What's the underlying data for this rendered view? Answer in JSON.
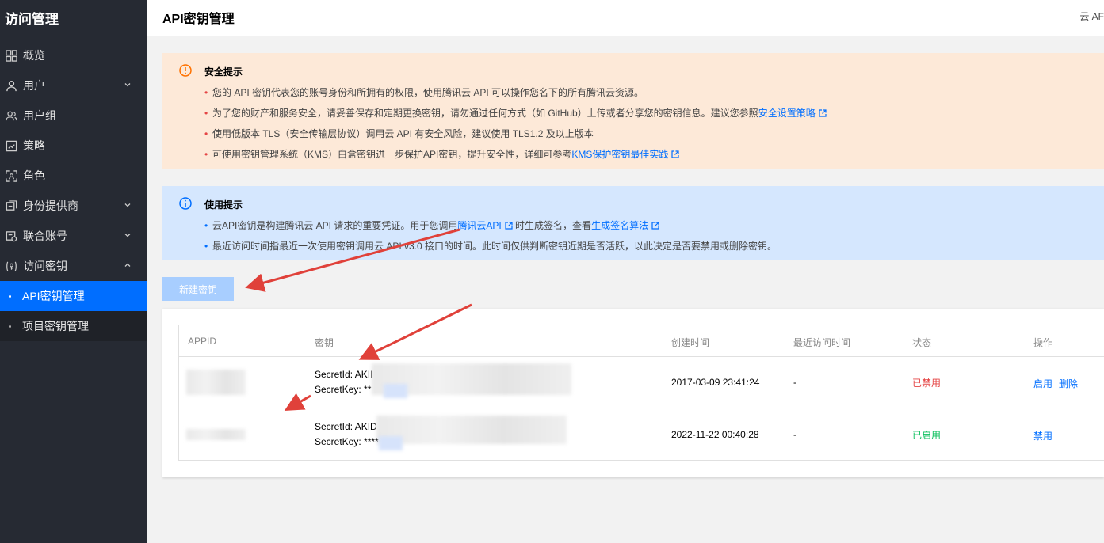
{
  "sidebar": {
    "title": "访问管理",
    "items": [
      {
        "label": "概览"
      },
      {
        "label": "用户"
      },
      {
        "label": "用户组"
      },
      {
        "label": "策略"
      },
      {
        "label": "角色"
      },
      {
        "label": "身份提供商"
      },
      {
        "label": "联合账号"
      },
      {
        "label": "访问密钥"
      }
    ],
    "sub_items": [
      {
        "label": "API密钥管理"
      },
      {
        "label": "项目密钥管理"
      }
    ]
  },
  "header": {
    "title": "API密钥管理",
    "right_text": "云 AF"
  },
  "security_notice": {
    "title": "安全提示",
    "items": [
      "您的 API 密钥代表您的账号身份和所拥有的权限，使用腾讯云 API 可以操作您名下的所有腾讯云资源。",
      "为了您的财产和服务安全，请妥善保存和定期更换密钥，请勿通过任何方式（如 GitHub）上传或者分享您的密钥信息。建议您参照",
      "使用低版本 TLS（安全传输层协议）调用云 API 有安全风险，建议使用 TLS1.2 及以上版本",
      "可使用密钥管理系统（KMS）白盒密钥进一步保护API密钥，提升安全性，详细可参考"
    ],
    "link_1": "安全设置策略",
    "link_2": "KMS保护密钥最佳实践"
  },
  "usage_notice": {
    "title": "使用提示",
    "item1_a": "云API密钥是构建腾讯云 API 请求的重要凭证。用于您调用",
    "item1_link1": "腾讯云API",
    "item1_b": "时生成签名，查看",
    "item1_link2": "生成签名算法",
    "item2": "最近访问时间指最近一次使用密钥调用云 API v3.0 接口的时间。此时间仅供判断密钥近期是否活跃，以此决定是否要禁用或删除密钥。"
  },
  "create_button": "新建密钥",
  "table": {
    "columns": [
      "APPID",
      "密钥",
      "创建时间",
      "最近访问时间",
      "状态",
      "操作"
    ],
    "rows": [
      {
        "secret_id": "SecretId: AKII",
        "secret_key": "SecretKey: **",
        "created": "2017-03-09 23:41:24",
        "last_access": "-",
        "status": "已禁用",
        "actions": [
          "启用",
          "删除"
        ]
      },
      {
        "secret_id": "SecretId: AKID",
        "secret_key": "SecretKey: ****",
        "created": "2022-11-22 00:40:28",
        "last_access": "-",
        "status": "已启用",
        "actions": [
          "禁用"
        ]
      }
    ]
  }
}
